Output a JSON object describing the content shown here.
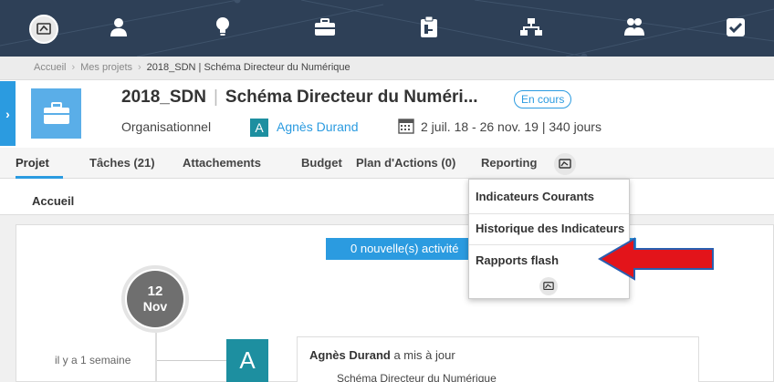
{
  "nav": {
    "items": [
      "home-icon",
      "user-icon",
      "lightbulb-icon",
      "briefcase-icon",
      "clipboard-icon",
      "org-chart-icon",
      "team-icon",
      "checkbox-icon"
    ]
  },
  "breadcrumb": {
    "home": "Accueil",
    "projects": "Mes projets",
    "current": "2018_SDN | Schéma Directeur du Numérique"
  },
  "project": {
    "code": "2018_SDN",
    "name": "Schéma Directeur du Numéri...",
    "status": "En cours",
    "type": "Organisationnel",
    "owner_initial": "A",
    "owner": "Agnès Durand",
    "dates": "2 juil. 18 - 26 nov. 19 | 340 jours"
  },
  "tabs": {
    "projet": "Projet",
    "taches": "Tâches (21)",
    "attachements": "Attachements",
    "budget": "Budget",
    "plan": "Plan d'Actions (0)",
    "reporting": "Reporting"
  },
  "subheader": {
    "title": "Accueil"
  },
  "dropdown": {
    "items": [
      "Indicateurs Courants",
      "Historique des Indicateurs",
      "Rapports flash"
    ]
  },
  "activity": {
    "banner": "0 nouvelle(s) activité",
    "date_day": "12",
    "date_month": "Nov",
    "relative_time": "il y a 1 semaine",
    "avatar_initial": "A",
    "author": "Agnès Durand",
    "action": " a mis à jour",
    "object": "Schéma Directeur du Numérique"
  },
  "colors": {
    "nav_bg": "#2e4057",
    "accent": "#2b9be0",
    "avatar_teal": "#1d8fa0",
    "arrow_red": "#e3141a"
  }
}
